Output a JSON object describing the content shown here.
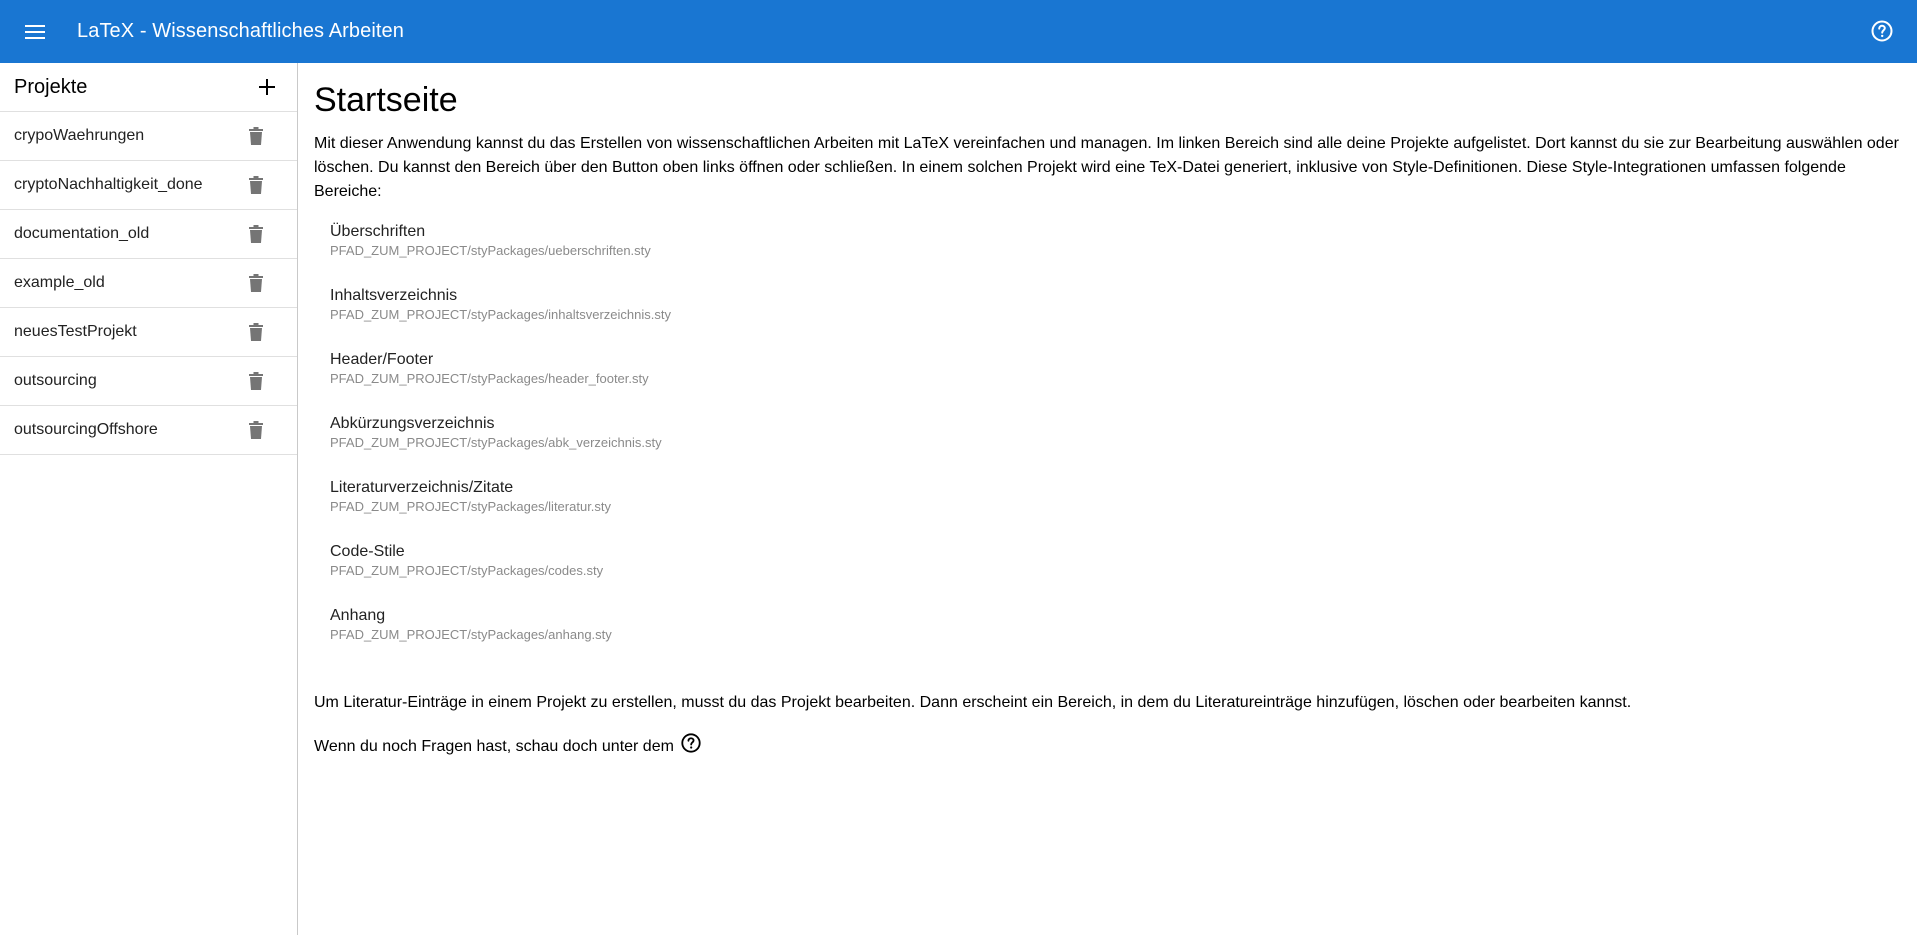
{
  "appbar": {
    "title": "LaTeX - Wissenschaftliches Arbeiten",
    "menu_icon": "menu-icon",
    "help_icon": "help-circle-icon",
    "color": "#1976d2"
  },
  "sidebar": {
    "title": "Projekte",
    "add_icon": "plus-icon",
    "projects": [
      {
        "label": "crypoWaehrungen"
      },
      {
        "label": "cryptoNachhaltigkeit_done"
      },
      {
        "label": "documentation_old"
      },
      {
        "label": "example_old"
      },
      {
        "label": "neuesTestProjekt"
      },
      {
        "label": "outsourcing"
      },
      {
        "label": "outsourcingOffshore"
      }
    ]
  },
  "main": {
    "title": "Startseite",
    "intro": "Mit dieser Anwendung kannst du das Erstellen von wissenschaftlichen Arbeiten mit LaTeX vereinfachen und managen. Im linken Bereich sind alle deine Projekte aufgelistet. Dort kannst du sie zur Bearbeitung auswählen oder löschen. Du kannst den Bereich über den Button oben links öffnen oder schließen. In einem solchen Projekt wird eine TeX-Datei generiert, inklusive von Style-Definitionen. Diese Style-Integrationen umfassen folgende Bereiche:",
    "sty_items": [
      {
        "name": "Überschriften",
        "path": "PFAD_ZUM_PROJECT/styPackages/ueberschriften.sty"
      },
      {
        "name": "Inhaltsverzeichnis",
        "path": "PFAD_ZUM_PROJECT/styPackages/inhaltsverzeichnis.sty"
      },
      {
        "name": "Header/Footer",
        "path": "PFAD_ZUM_PROJECT/styPackages/header_footer.sty"
      },
      {
        "name": "Abkürzungsverzeichnis",
        "path": "PFAD_ZUM_PROJECT/styPackages/abk_verzeichnis.sty"
      },
      {
        "name": "Literaturverzeichnis/Zitate",
        "path": "PFAD_ZUM_PROJECT/styPackages/literatur.sty"
      },
      {
        "name": "Code-Stile",
        "path": "PFAD_ZUM_PROJECT/styPackages/codes.sty"
      },
      {
        "name": "Anhang",
        "path": "PFAD_ZUM_PROJECT/styPackages/anhang.sty"
      }
    ],
    "paragraph2": "Um Literatur-Einträge in einem Projekt zu erstellen, musst du das Projekt bearbeiten. Dann erscheint ein Bereich, in dem du Literatureinträge hinzufügen, löschen oder bearbeiten kannst.",
    "paragraph3": "Wenn du noch Fragen hast, schau doch unter dem"
  }
}
